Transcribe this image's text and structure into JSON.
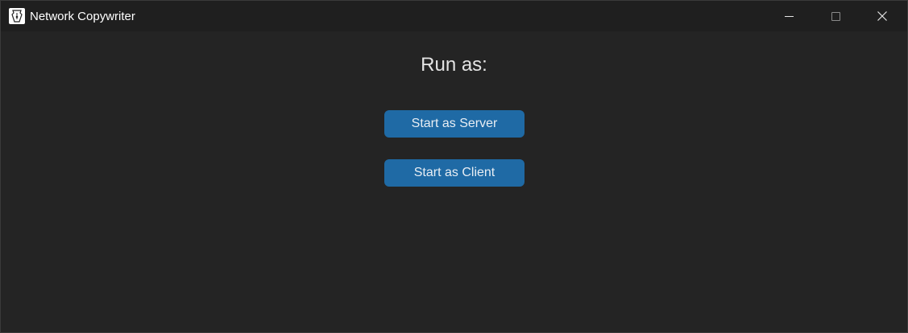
{
  "window": {
    "title": "Network Copywriter",
    "controls": {
      "minimize_icon": "minimize-icon",
      "maximize_icon": "maximize-icon",
      "close_icon": "close-icon"
    }
  },
  "main": {
    "heading": "Run as:",
    "server_button_label": "Start as Server",
    "client_button_label": "Start as Client"
  },
  "colors": {
    "background": "#242424",
    "titlebar": "#1f1f1f",
    "button": "#1f6aa5"
  }
}
